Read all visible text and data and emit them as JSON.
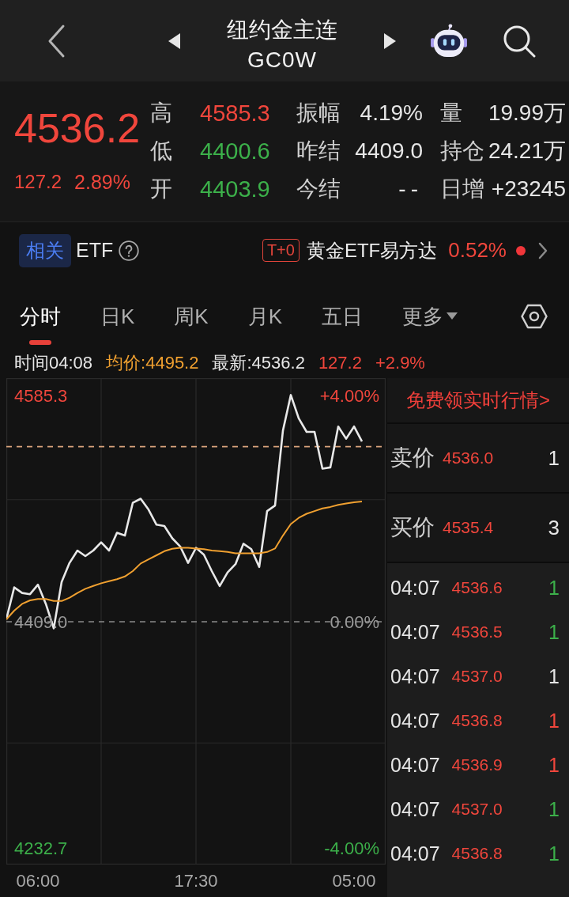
{
  "header": {
    "title": "纽约金主连",
    "code": "GC0W"
  },
  "quote": {
    "color": "#f0463c",
    "price": "4536.2",
    "change": "127.2",
    "change_pct": "2.89%",
    "stat_columns": [
      [
        {
          "label": "高",
          "value": "4585.3",
          "color": "#f0463c"
        },
        {
          "label": "低",
          "value": "4400.6",
          "color": "#3cb04a"
        },
        {
          "label": "开",
          "value": "4403.9",
          "color": "#3cb04a"
        }
      ],
      [
        {
          "label": "振幅",
          "value": "4.19%"
        },
        {
          "label": "昨结",
          "value": "4409.0"
        },
        {
          "label": "今结",
          "value": "--"
        }
      ],
      [
        {
          "label": "量",
          "value": "19.99万"
        },
        {
          "label": "持仓",
          "value": "24.21万"
        },
        {
          "label": "日增",
          "value": "+23245"
        }
      ]
    ]
  },
  "related": {
    "tag": "相关",
    "label": "ETF",
    "badge": "T+0",
    "fund": "黄金ETF易方达",
    "change": "0.52%"
  },
  "tabs": [
    {
      "label": "分时",
      "selected": true,
      "kind": "tab"
    },
    {
      "label": "日K",
      "selected": false,
      "kind": "tab"
    },
    {
      "label": "周K",
      "selected": false,
      "kind": "tab"
    },
    {
      "label": "月K",
      "selected": false,
      "kind": "tab"
    },
    {
      "label": "五日",
      "selected": false,
      "kind": "tab"
    },
    {
      "label": "更多",
      "selected": false,
      "kind": "menu"
    }
  ],
  "info_line": [
    {
      "text": "时间04:08",
      "color": "#e6e6e6"
    },
    {
      "text": "均价:4495.2",
      "color": "#f0a030"
    },
    {
      "text": "最新:4536.2",
      "color": "#e6e6e6"
    },
    {
      "text": "127.2",
      "color": "#f0463c"
    },
    {
      "text": "+2.9%",
      "color": "#f0463c"
    }
  ],
  "chart": {
    "right_labels": [
      "+4.00%",
      "0.00%",
      "-4.00%"
    ],
    "chart_data": {
      "type": "line",
      "categories": [
        null,
        null,
        null,
        null,
        "06:00",
        null,
        null,
        null,
        null,
        null,
        null,
        null,
        null,
        null,
        null,
        null,
        null,
        null,
        null,
        null,
        null,
        null,
        null,
        null,
        "17:30",
        null,
        null,
        null,
        null,
        null,
        null,
        null,
        null,
        null,
        null,
        null,
        null,
        null,
        null,
        null,
        null,
        null,
        null,
        null,
        "05:00",
        null,
        null,
        null,
        null
      ],
      "series": [
        {
          "color": "#e8e8e8",
          "values": [
            4410.9,
            4435.8,
            4431.5,
            4430.5,
            4437.9,
            4423.0,
            4403.9,
            4440.0,
            4454.9,
            4464.5,
            4460.2,
            4464.5,
            4470.9,
            4464.5,
            4478.3,
            4476.2,
            4501.7,
            4504.9,
            4496.4,
            4484.7,
            4483.6,
            4474.1,
            4467.7,
            4454.9,
            4466.6,
            4461.3,
            4448.5,
            4436.9,
            4447.5,
            4453.9,
            4469.8,
            4465.6,
            4451.7,
            4495.3,
            4499.6,
            4558.0,
            4585.7,
            4567.6,
            4557.0,
            4557.0,
            4528.3,
            4529.3,
            4561.2,
            4551.7,
            4561.2,
            4549.5,
            null,
            null,
            null
          ]
        },
        {
          "color": "#f0a030",
          "values": [
            4410.9,
            4417.7,
            4423.0,
            4425.7,
            4426.8,
            4426.8,
            4425.2,
            4425.2,
            4427.8,
            4431.5,
            4434.7,
            4436.9,
            4439.0,
            4440.6,
            4442.2,
            4444.3,
            4448.5,
            4454.4,
            4457.6,
            4460.8,
            4464.0,
            4465.9,
            4466.6,
            4466.6,
            4466.1,
            4465.6,
            4464.5,
            4464.0,
            4463.4,
            4462.4,
            4462.4,
            4462.4,
            4462.4,
            4463.4,
            4466.1,
            4476.2,
            4485.2,
            4490.0,
            4493.2,
            4495.3,
            4497.4,
            4498.5,
            4500.1,
            4501.2,
            4502.2,
            4502.8,
            null,
            null,
            null
          ]
        }
      ],
      "ylim": [
        4219.8,
        4598.9
      ],
      "yticks": [
        {
          "value": 4585.3,
          "label": "4585.3"
        },
        {
          "value": 4409.0,
          "label": "4409.0"
        },
        {
          "value": 4232.7,
          "label": "4232.7"
        }
      ],
      "ref_lines": [
        {
          "axis": "y",
          "value": 4545.5,
          "color": "#d9a47c"
        },
        {
          "axis": "y",
          "value": 4409.0,
          "color": "#8c8c8c"
        }
      ]
    }
  },
  "side_panel": {
    "link": "免费领实时行情>",
    "order_book": [
      {
        "label": "卖价",
        "price": "4536.0",
        "volume": "1"
      },
      {
        "label": "买价",
        "price": "4535.4",
        "volume": "3"
      }
    ],
    "trades": [
      {
        "time": "04:07",
        "price": "4536.6",
        "volume": "1",
        "color": "#3cb04a"
      },
      {
        "time": "04:07",
        "price": "4536.5",
        "volume": "1",
        "color": "#3cb04a"
      },
      {
        "time": "04:07",
        "price": "4537.0",
        "volume": "1",
        "color": "#e6e6e6"
      },
      {
        "time": "04:07",
        "price": "4536.8",
        "volume": "1",
        "color": "#f0463c"
      },
      {
        "time": "04:07",
        "price": "4536.9",
        "volume": "1",
        "color": "#f0463c"
      },
      {
        "time": "04:07",
        "price": "4537.0",
        "volume": "1",
        "color": "#3cb04a"
      },
      {
        "time": "04:07",
        "price": "4536.8",
        "volume": "1",
        "color": "#3cb04a"
      }
    ]
  }
}
